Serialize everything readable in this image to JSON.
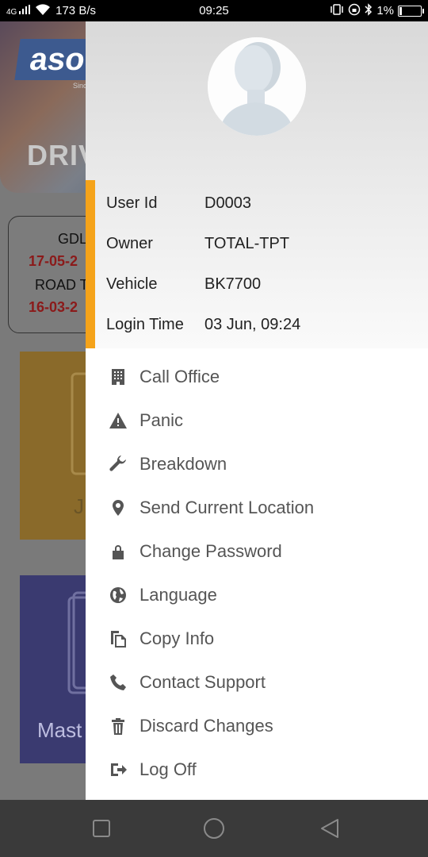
{
  "statusbar": {
    "network": "4G",
    "speed": "173 B/s",
    "time": "09:25",
    "battery": "1%"
  },
  "background": {
    "logo_text": "aso",
    "logo_sub": "Sinc",
    "banner_text": "DRIV",
    "card_lines": [
      "GDL",
      "17-05-2",
      "ROAD T",
      "16-03-2"
    ],
    "tile1_label": "J",
    "tile2_label": "Mast"
  },
  "drawer": {
    "user_info": [
      {
        "key": "User Id",
        "value": "D0003"
      },
      {
        "key": "Owner",
        "value": "TOTAL-TPT"
      },
      {
        "key": "Vehicle",
        "value": "BK7700"
      },
      {
        "key": "Login Time",
        "value": "03 Jun, 09:24"
      }
    ],
    "menu": [
      {
        "label": "Call Office",
        "icon": "building-icon"
      },
      {
        "label": "Panic",
        "icon": "warning-icon"
      },
      {
        "label": "Breakdown",
        "icon": "wrench-icon"
      },
      {
        "label": "Send Current Location",
        "icon": "location-pin-icon"
      },
      {
        "label": "Change Password",
        "icon": "lock-icon"
      },
      {
        "label": "Language",
        "icon": "globe-icon"
      },
      {
        "label": "Copy Info",
        "icon": "copy-icon"
      },
      {
        "label": "Contact Support",
        "icon": "phone-icon"
      },
      {
        "label": "Discard Changes",
        "icon": "trash-icon"
      },
      {
        "label": "Log Off",
        "icon": "logout-icon"
      }
    ]
  },
  "colors": {
    "accent": "#f5a31a",
    "menu_text": "#555555"
  }
}
